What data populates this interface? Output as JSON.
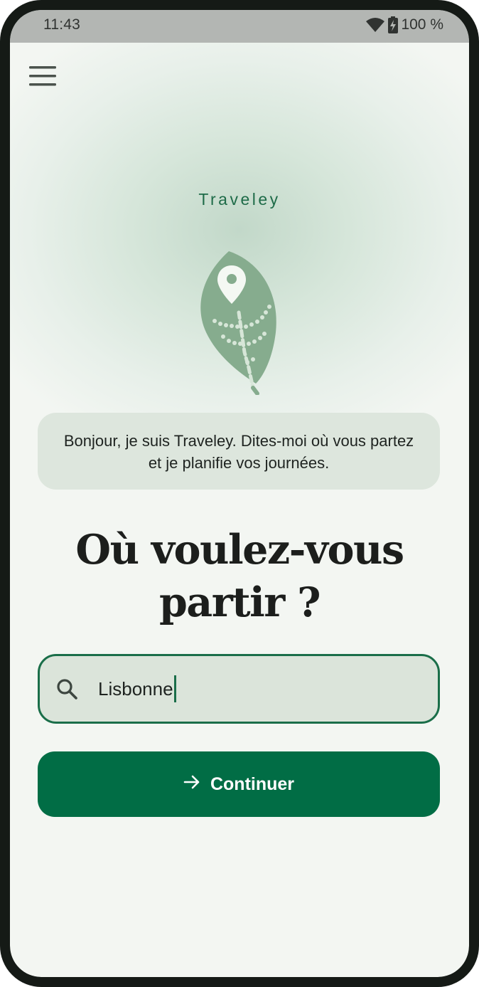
{
  "status_bar": {
    "time": "11:43",
    "battery": "100 %",
    "icons": [
      "wifi-icon",
      "battery-icon"
    ]
  },
  "header": {
    "menu_icon": "hamburger-menu-icon"
  },
  "brand": {
    "name": "Traveley",
    "logo_icon": "leaf-location-pin-icon"
  },
  "intro": {
    "message": "Bonjour, je suis Traveley. Dites-moi où vous partez et je planifie vos journées."
  },
  "headline": {
    "title": "Où voulez-vous partir ?"
  },
  "search": {
    "value": "Lisbonne",
    "icon": "search-icon"
  },
  "cta": {
    "label": "Continuer",
    "icon": "arrow-right-icon"
  },
  "colors": {
    "accent": "#016d45",
    "brand_text": "#1e6b48",
    "background": "#f3f6f2",
    "bubble": "#dde6dd",
    "input_fill": "#dbe4da",
    "leaf": "#86ac8e"
  }
}
